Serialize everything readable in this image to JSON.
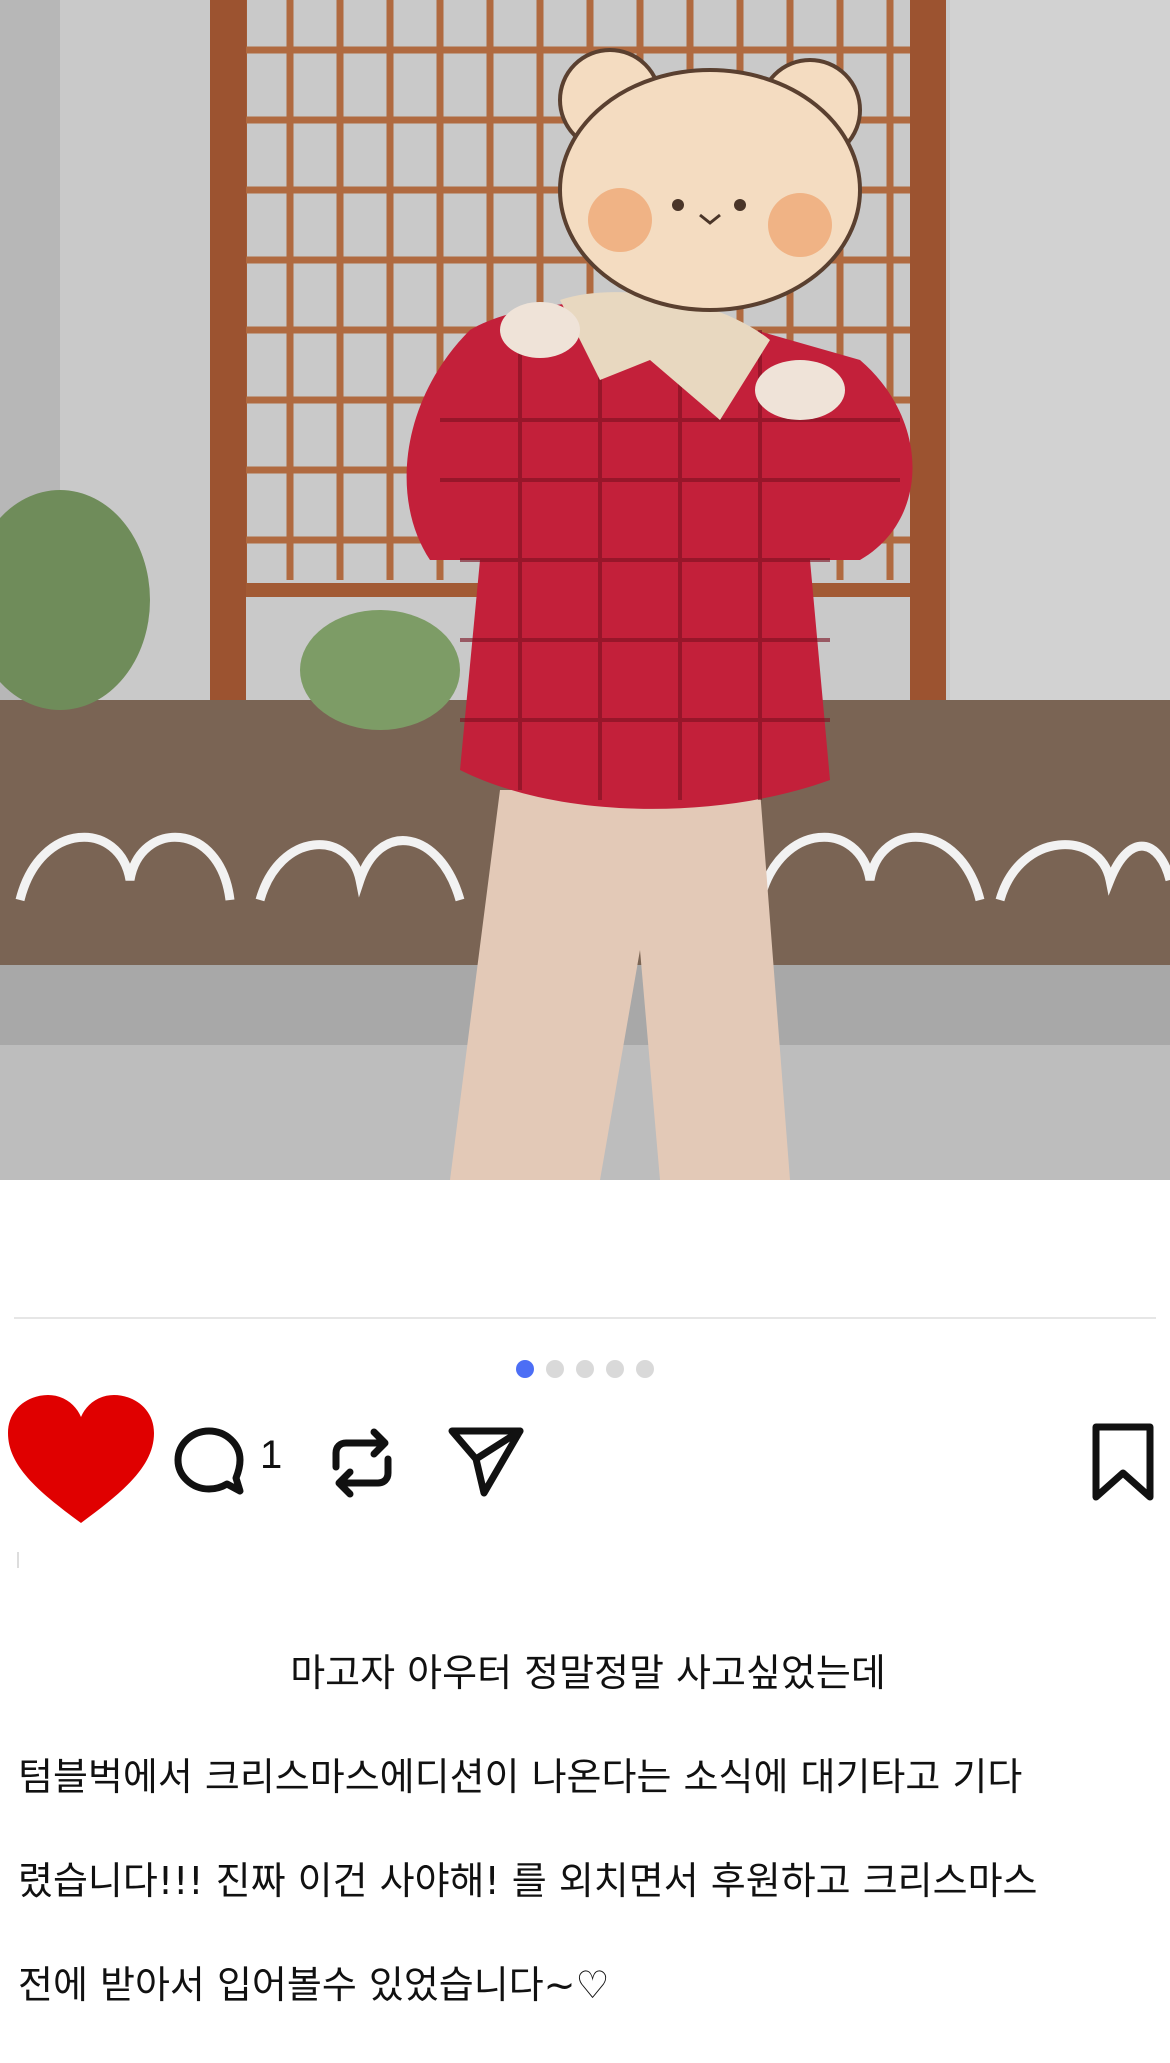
{
  "post": {
    "comment_count": "1",
    "carousel": {
      "total": 5,
      "active": 0
    },
    "caption_lines": [
      "마고자 아우터 정말정말 사고싶었는데",
      "텀블벅에서 크리스마스에디션이 나온다는 소식에 대기타고 기다",
      "렸습니다!!! 진짜 이건 사야해! 를 외치면서 후원하고 크리스마스",
      "전에 받아서 입어볼수 있었습니다~♡"
    ]
  },
  "icons": {
    "like": "heart-filled-icon",
    "comment": "speech-bubble-icon",
    "repost": "repost-arrows-icon",
    "share": "paper-plane-icon",
    "save": "bookmark-icon"
  },
  "colors": {
    "like": "#e00000",
    "active_dot": "#4c6ef5",
    "inactive_dot": "#d9d9d9"
  }
}
